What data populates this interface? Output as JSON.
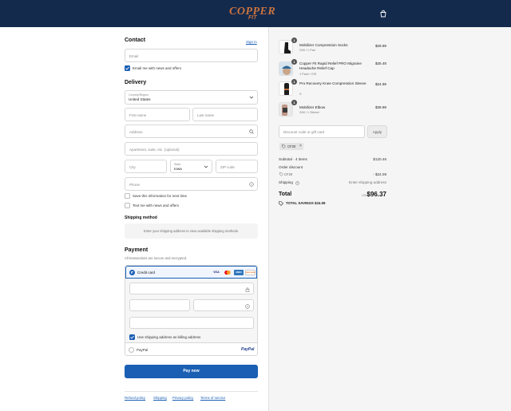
{
  "header": {
    "logo_word": "COPPER",
    "logo_sub": "FIT",
    "cart_icon": "cart-icon"
  },
  "contact": {
    "title": "Contact",
    "sign_in": "Sign in",
    "email_placeholder": "Email",
    "email_opt_in": "Email me with news and offers",
    "email_opt_in_checked": true
  },
  "delivery": {
    "title": "Delivery",
    "country_label": "Country/Region",
    "country_value": "United States",
    "first_name": "First name",
    "last_name": "Last name",
    "address": "Address",
    "apartment": "Apartment, suite, etc. (optional)",
    "city": "City",
    "state_label": "State",
    "state_value": "Iowa",
    "zip": "ZIP code",
    "phone": "Phone",
    "save_info": "Save this information for next time",
    "text_opt_in": "Text me with news and offers"
  },
  "shipping": {
    "title": "Shipping method",
    "message": "Enter your shipping address to view available shipping methods."
  },
  "payment": {
    "title": "Payment",
    "subtitle": "All transactions are secure and encrypted.",
    "credit_card": "Credit card",
    "card_brands": [
      "VISA",
      "MC",
      "AMEX",
      "DISCOVER"
    ],
    "billing_same": "Use shipping address as billing address",
    "billing_same_checked": true,
    "paypal": "PayPal",
    "paypal_logo": "PayPal"
  },
  "pay_button": "Pay now",
  "footer": {
    "links": [
      "Refund policy",
      "Shipping",
      "Privacy policy",
      "Terms of service"
    ]
  },
  "cart": {
    "items": [
      {
        "qty": "1",
        "name": "Mobilizer Compression Socks",
        "variant": "S/M / 1 Pair",
        "price": "$29.99"
      },
      {
        "qty": "1",
        "name": "Copper Fit Rapid Relief PRO Migraine Headache Relief Cap",
        "variant": "1 Pack / O/S",
        "price": "$25.49"
      },
      {
        "qty": "1",
        "name": "Pro Recovery Knee Compression Sleeve",
        "variant": "S",
        "price": "$24.99"
      },
      {
        "qty": "1",
        "name": "Mobilizer Elbow",
        "variant": "S/M / 1 Sleeve",
        "price": "$39.99"
      }
    ],
    "discount_placeholder": "Discount code or gift card",
    "apply": "Apply",
    "code_tag": "CF20"
  },
  "summary": {
    "subtotal_label": "Subtotal · 4 items",
    "subtotal_value": "$120.46",
    "order_discount_label": "Order discount",
    "code": "CF20",
    "discount_value": "- $24.09",
    "shipping_label": "Shipping",
    "shipping_value": "Enter shipping address",
    "total_label": "Total",
    "currency": "USD",
    "total_value": "$96.37",
    "savings": "TOTAL SAVINGS  $24.09"
  }
}
